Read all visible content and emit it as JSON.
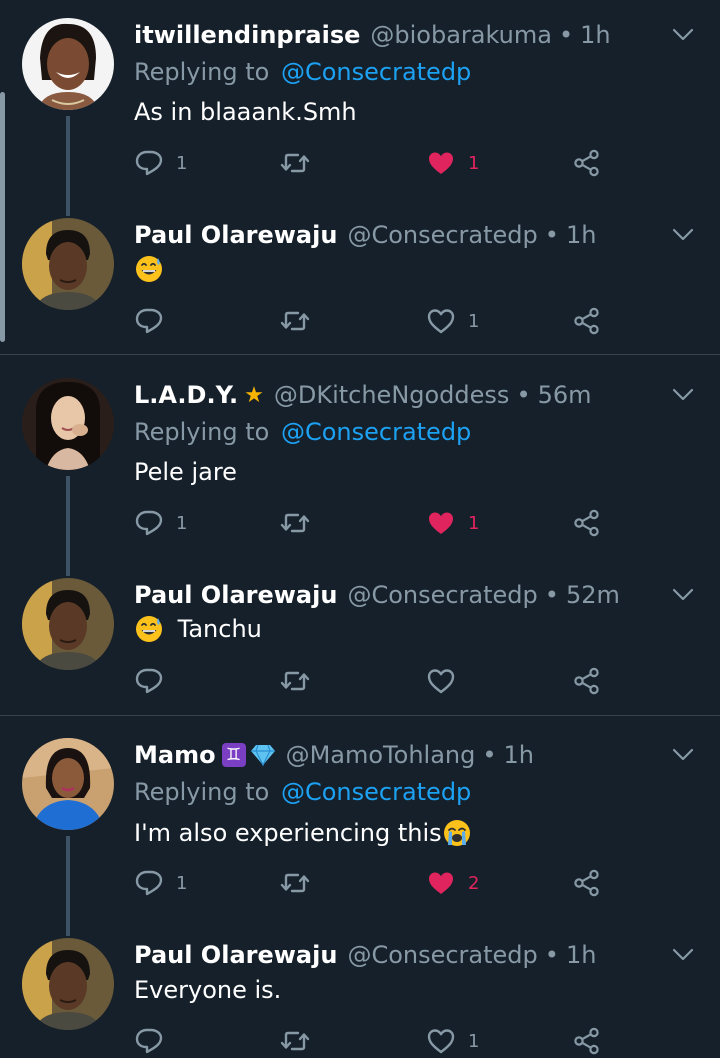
{
  "tweets": [
    {
      "name": "itwillendinpraise",
      "handle": "@biobarakuma",
      "time": "1h",
      "replying_label": "Replying to",
      "replying_to": "@Consecratedp",
      "text": "As in blaaank.Smh",
      "reply_count": "1",
      "retweet_count": "",
      "like_count": "1",
      "liked": true
    },
    {
      "name": "Paul Olarewaju",
      "handle": "@Consecratedp",
      "time": "1h",
      "text": "",
      "emoji": "sweat-smile",
      "reply_count": "",
      "retweet_count": "",
      "like_count": "1",
      "liked": false
    },
    {
      "name": "L.A.D.Y.",
      "name_badge": "star",
      "handle": "@DKitcheNgoddess",
      "time": "56m",
      "replying_label": "Replying to",
      "replying_to": "@Consecratedp",
      "text": "Pele jare",
      "reply_count": "1",
      "retweet_count": "",
      "like_count": "1",
      "liked": true
    },
    {
      "name": "Paul Olarewaju",
      "handle": "@Consecratedp",
      "time": "52m",
      "text": "Tanchu",
      "emoji": "sweat-smile",
      "reply_count": "",
      "retweet_count": "",
      "like_count": "",
      "liked": false
    },
    {
      "name": "Mamo",
      "name_badge": "gemini-diamond",
      "handle": "@MamoTohlang",
      "time": "1h",
      "replying_label": "Replying to",
      "replying_to": "@Consecratedp",
      "text": "I'm also experiencing this",
      "emoji_after": "crying",
      "reply_count": "1",
      "retweet_count": "",
      "like_count": "2",
      "liked": true
    },
    {
      "name": "Paul Olarewaju",
      "handle": "@Consecratedp",
      "time": "1h",
      "text": "Everyone is.",
      "reply_count": "",
      "retweet_count": "",
      "like_count": "1",
      "liked": false
    }
  ],
  "separator": "•",
  "colors": {
    "background": "#15202b",
    "secondary_text": "#8899a6",
    "link": "#1da1f2",
    "like": "#e0245e",
    "divider": "#38444d"
  },
  "icons": {
    "reply": "reply-icon",
    "retweet": "retweet-icon",
    "like": "heart-icon",
    "share": "share-icon",
    "more": "chevron-down-icon"
  }
}
